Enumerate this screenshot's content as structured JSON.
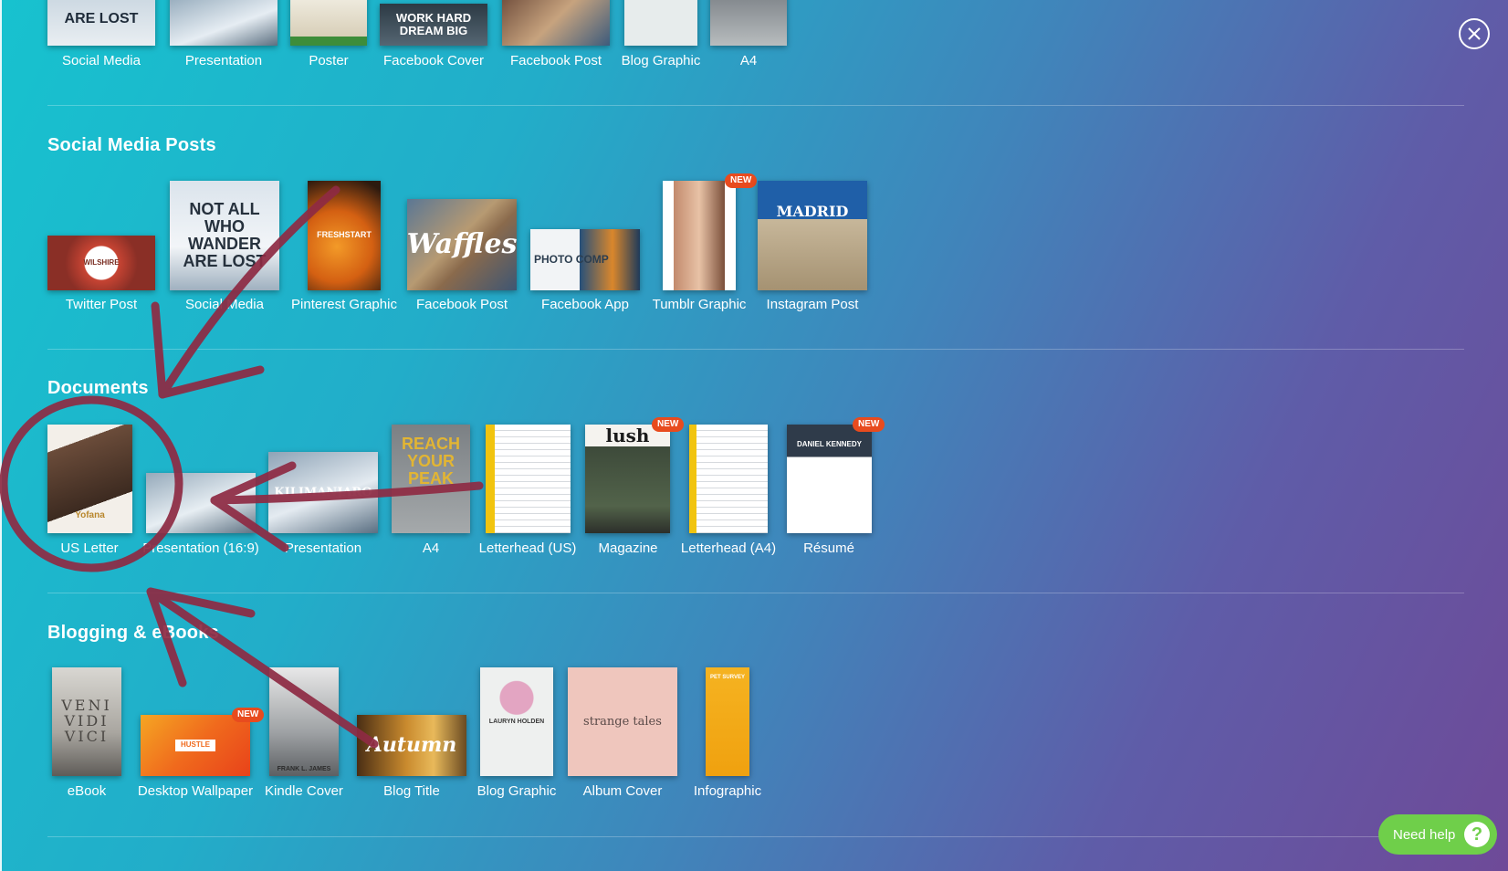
{
  "colors": {
    "arrow": "#8e2a43",
    "badge": "#e84b1e",
    "help": "#6fcf4a"
  },
  "badge_text": "NEW",
  "top_row": [
    {
      "label": "Social Media",
      "thumb_text": "ARE LOST"
    },
    {
      "label": "Presentation",
      "thumb_text": ""
    },
    {
      "label": "Poster",
      "thumb_text": ""
    },
    {
      "label": "Facebook Cover",
      "thumb_text": "WORK HARD DREAM BIG"
    },
    {
      "label": "Facebook Post",
      "thumb_text": ""
    },
    {
      "label": "Blog Graphic",
      "thumb_text": ""
    },
    {
      "label": "A4",
      "thumb_text": ""
    }
  ],
  "sections": {
    "social": {
      "title": "Social Media Posts",
      "items": [
        {
          "label": "Twitter Post",
          "thumb_text": "WILSHIRE"
        },
        {
          "label": "Social Media",
          "thumb_text": "NOT ALL WHO WANDER ARE LOST"
        },
        {
          "label": "Pinterest Graphic",
          "thumb_text": "FRESHSTART"
        },
        {
          "label": "Facebook Post",
          "thumb_text": "Waffles"
        },
        {
          "label": "Facebook App",
          "thumb_text": "PHOTO COMP"
        },
        {
          "label": "Tumblr Graphic",
          "thumb_text": ""
        },
        {
          "label": "Instagram Post",
          "thumb_text": "MADRID"
        }
      ]
    },
    "documents": {
      "title": "Documents",
      "items": [
        {
          "label": "US Letter",
          "thumb_text": "Yofana"
        },
        {
          "label": "Presentation (16:9)",
          "thumb_text": ""
        },
        {
          "label": "Presentation",
          "thumb_text": "KILIMANJARO"
        },
        {
          "label": "A4",
          "thumb_text": "REACH YOUR PEAK"
        },
        {
          "label": "Letterhead (US)",
          "thumb_text": ""
        },
        {
          "label": "Magazine",
          "thumb_text": "lush"
        },
        {
          "label": "Letterhead (A4)",
          "thumb_text": ""
        },
        {
          "label": "Résumé",
          "thumb_text": "DANIEL KENNEDY"
        }
      ]
    },
    "blogging": {
      "title": "Blogging & eBooks",
      "items": [
        {
          "label": "eBook",
          "thumb_text": "VENI VIDI VICI"
        },
        {
          "label": "Desktop Wallpaper",
          "thumb_text": "HUSTLE"
        },
        {
          "label": "Kindle Cover",
          "thumb_text": "FRANK L. JAMES"
        },
        {
          "label": "Blog Title",
          "thumb_text": "Autumn"
        },
        {
          "label": "Blog Graphic",
          "thumb_text": "LAURYN HOLDEN"
        },
        {
          "label": "Album Cover",
          "thumb_text": "strange tales"
        },
        {
          "label": "Infographic",
          "thumb_text": "PET SURVEY"
        }
      ]
    }
  },
  "help": {
    "label": "Need help",
    "icon": "?"
  },
  "close_icon": "close-circle-icon"
}
